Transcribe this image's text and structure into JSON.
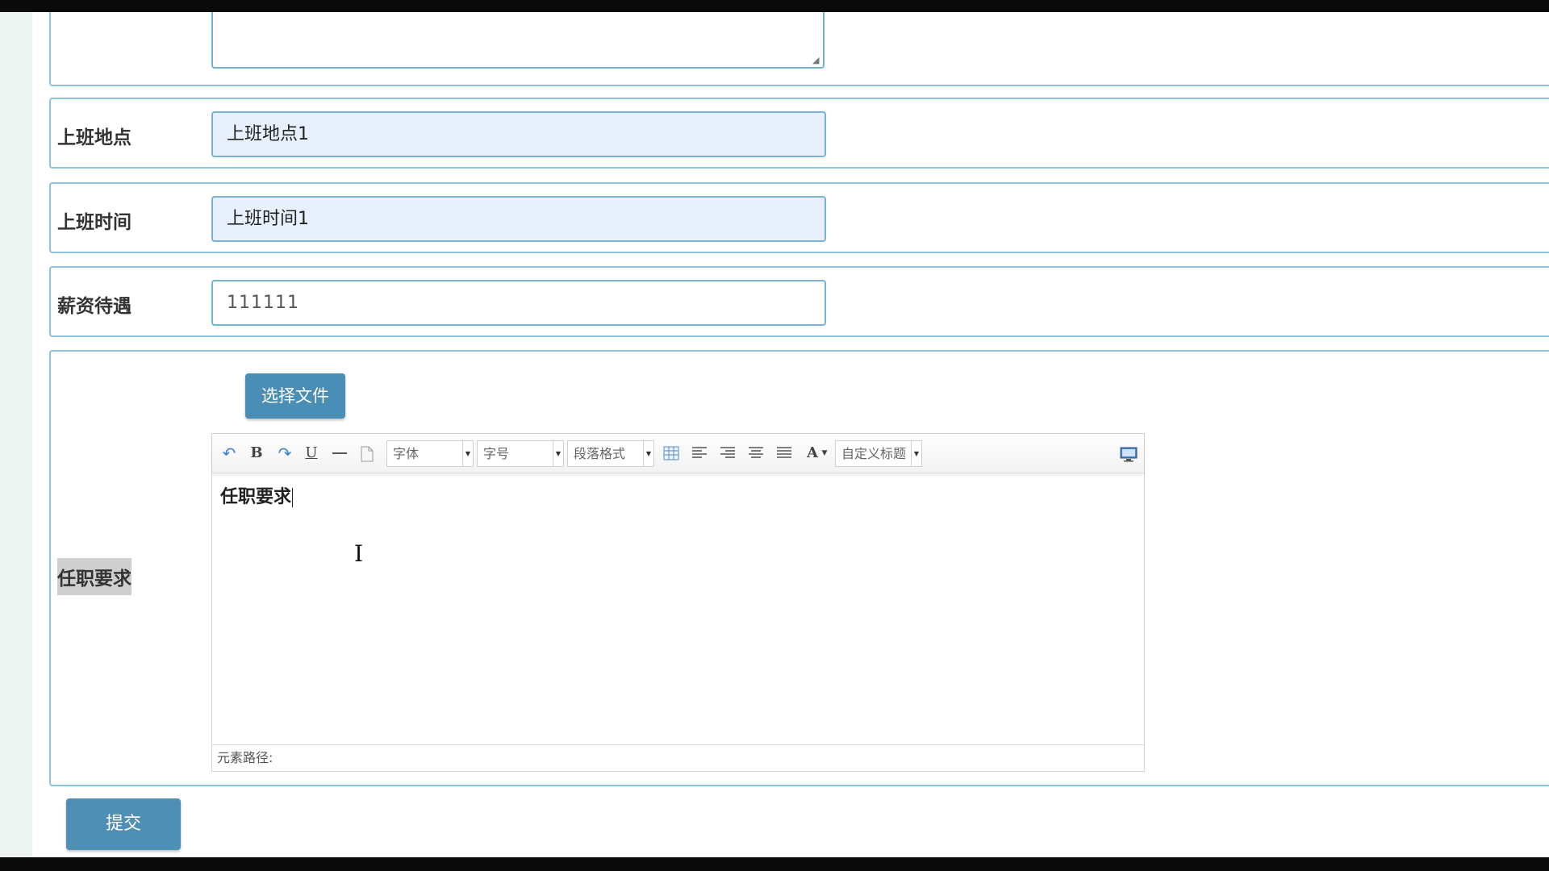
{
  "form": {
    "rows": [
      {
        "label": "上班地点",
        "value": "上班地点1"
      },
      {
        "label": "上班时间",
        "value": "上班时间1"
      },
      {
        "label": "薪资待遇",
        "value": "111111"
      }
    ],
    "requirements": {
      "label": "任职要求",
      "choose_file_label": "选择文件",
      "editor": {
        "font_family_placeholder": "字体",
        "font_size_placeholder": "字号",
        "paragraph_placeholder": "段落格式",
        "custom_title_placeholder": "自定义标题",
        "content": "任职要求",
        "status_path": "元素路径:",
        "bold_glyph": "B",
        "underline_glyph": "U",
        "font_color_glyph": "A",
        "toolbar_icons": [
          "undo-icon",
          "bold-icon",
          "redo-icon",
          "underline-icon",
          "horizontal-rule-icon",
          "page-icon",
          "table-icon",
          "align-left-icon",
          "align-right-icon",
          "align-center-icon",
          "justify-icon",
          "font-color-icon",
          "fullscreen-icon"
        ]
      }
    },
    "submit_label": "提交"
  },
  "colors": {
    "accent": "#4a8db5",
    "border": "#8fc3dd",
    "autofill": "#e8f0fe"
  }
}
